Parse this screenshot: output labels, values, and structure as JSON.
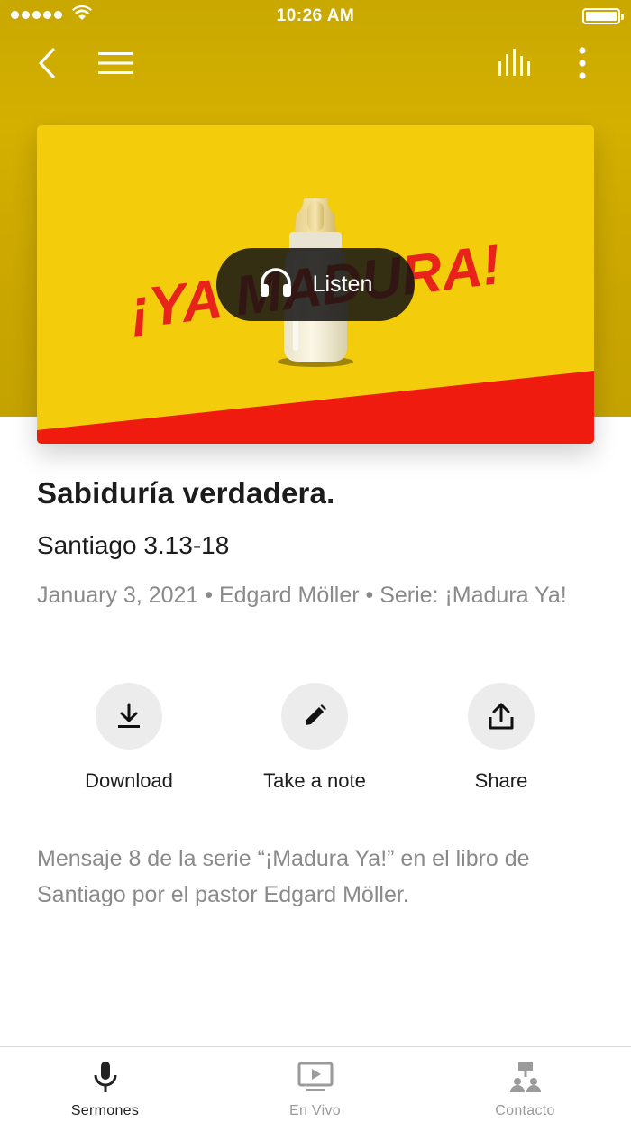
{
  "status_bar": {
    "time": "10:26 AM"
  },
  "nav": {
    "back_icon": "chevron-left-icon",
    "menu_icon": "hamburger-menu-icon",
    "audio_icon": "audio-levels-icon",
    "more_icon": "more-vertical-icon"
  },
  "artwork": {
    "logo_text": "¡YA MADURA!",
    "colors": {
      "yellow": "#f3cc0c",
      "red": "#ee1b0e"
    }
  },
  "listen": {
    "label": "Listen",
    "icon": "headphones-icon"
  },
  "sermon": {
    "title": "Sabiduría verdadera.",
    "passage": "Santiago 3.13-18",
    "meta": "January 3, 2021 • Edgard Möller • Serie: ¡Madura Ya!",
    "description": "Mensaje 8 de la serie “¡Madura Ya!” en el libro de Santiago por el pastor Edgard Möller."
  },
  "actions": [
    {
      "label": "Download",
      "icon": "download-icon"
    },
    {
      "label": "Take a note",
      "icon": "pencil-icon"
    },
    {
      "label": "Share",
      "icon": "share-icon"
    }
  ],
  "tabs": [
    {
      "label": "Sermones",
      "icon": "microphone-icon",
      "active": true
    },
    {
      "label": "En Vivo",
      "icon": "tv-play-icon",
      "active": false
    },
    {
      "label": "Contacto",
      "icon": "contact-people-icon",
      "active": false
    }
  ],
  "colors": {
    "tab_active": "#222222",
    "tab_inactive": "#9b9b9b",
    "hero_bg": "#cca900"
  }
}
